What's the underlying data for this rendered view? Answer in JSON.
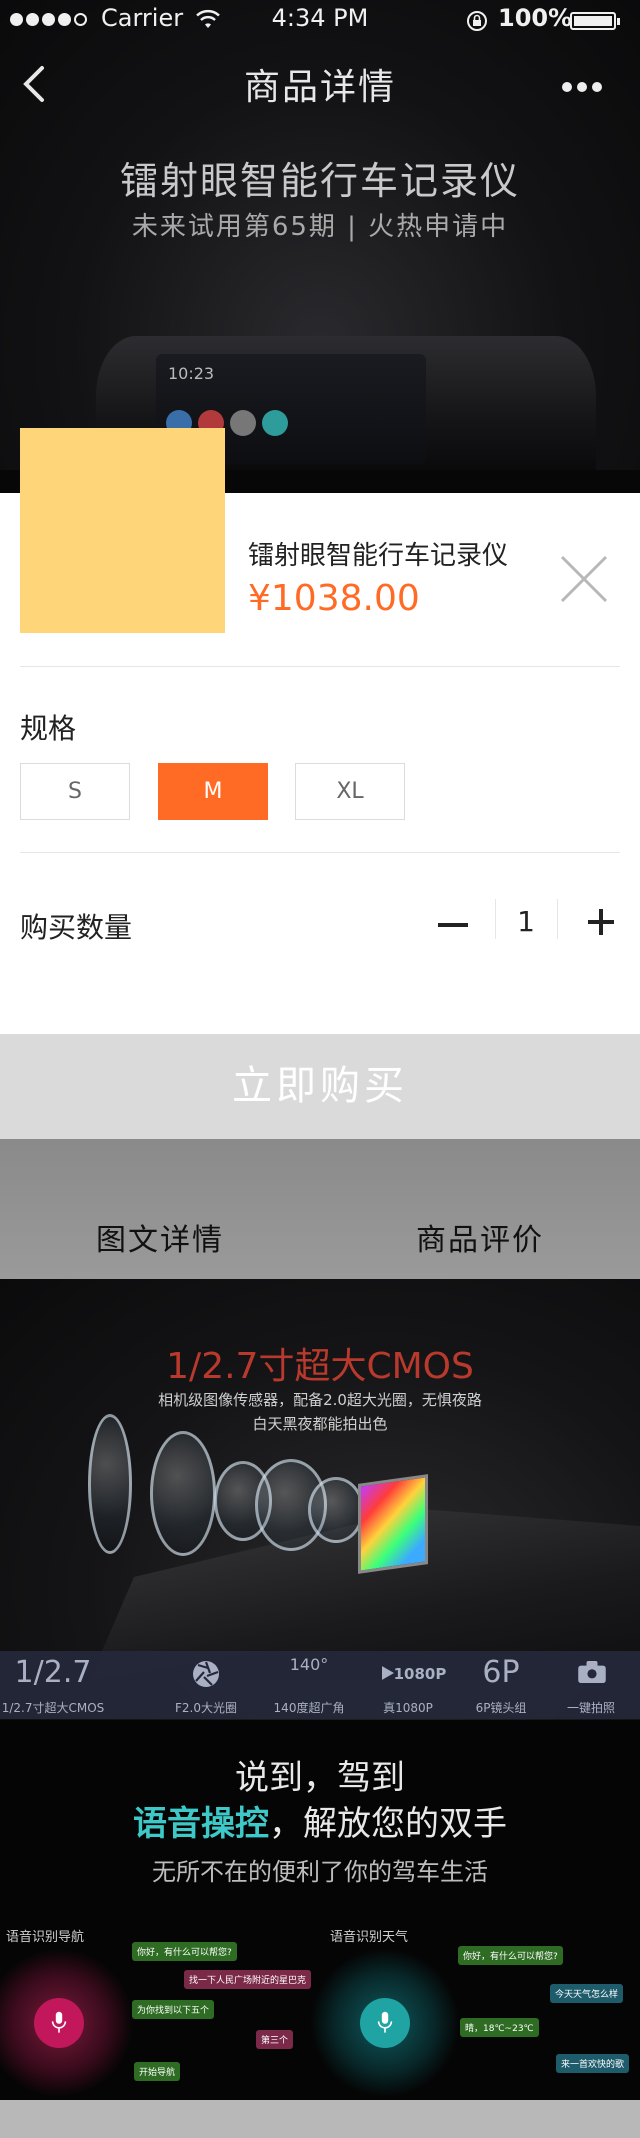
{
  "status_bar": {
    "carrier": "Carrier",
    "time": "4:34 PM",
    "battery": "100%",
    "battery_level": 1.0
  },
  "nav": {
    "title": "商品详情"
  },
  "hero": {
    "title": "镭射眼智能行车记录仪",
    "subtitle": "未来试用第65期 | 火热申请中",
    "device_time": "10:23"
  },
  "product": {
    "name": "镭射眼智能行车记录仪",
    "price": "¥1038.00",
    "thumbnail_color": "#ffd57a"
  },
  "spec": {
    "label": "规格",
    "options": [
      "S",
      "M",
      "XL"
    ],
    "selected": "M"
  },
  "quantity": {
    "label": "购买数量",
    "value": "1"
  },
  "buy_button": {
    "label": "立即购买"
  },
  "tabs": [
    "图文详情",
    "商品评价"
  ],
  "detail_cmos": {
    "title": "1/2.7寸超大CMOS",
    "line1": "相机级图像传感器，配备2.0超大光圈，无惧夜路",
    "line2": "白天黑夜都能拍出色",
    "features": [
      {
        "top": "1/2.7",
        "label": "1/2.7寸超大CMOS"
      },
      {
        "top": "",
        "label": "F2.0大光圈",
        "icon": "aperture-icon"
      },
      {
        "top": "140°",
        "label": "140度超广角"
      },
      {
        "top": "1080P",
        "label": "真1080P",
        "icon": "video-camera-icon"
      },
      {
        "top": "6P",
        "label": "6P镜头组"
      },
      {
        "top": "",
        "label": "一键拍照",
        "icon": "camera-icon"
      }
    ]
  },
  "detail_voice": {
    "line1": "说到，驾到",
    "line2_accent": "语音操控",
    "line2_rest": "，解放您的双手",
    "line3": "无所不在的便利了你的驾车生活",
    "nav_title": "语音识别导航",
    "weather_title": "语音识别天气",
    "nav_bubbles": [
      "你好，有什么可以帮您?",
      "找一下人民广场附近的星巴克",
      "为你找到以下五个",
      "第三个",
      "开始导航"
    ],
    "weather_bubbles": [
      "你好，有什么可以帮您?",
      "今天天气怎么样",
      "晴，18℃~23℃",
      "来一首欢快的歌"
    ]
  },
  "colors": {
    "accent": "#ff6a24",
    "voice_accent": "#3ec8c8"
  }
}
